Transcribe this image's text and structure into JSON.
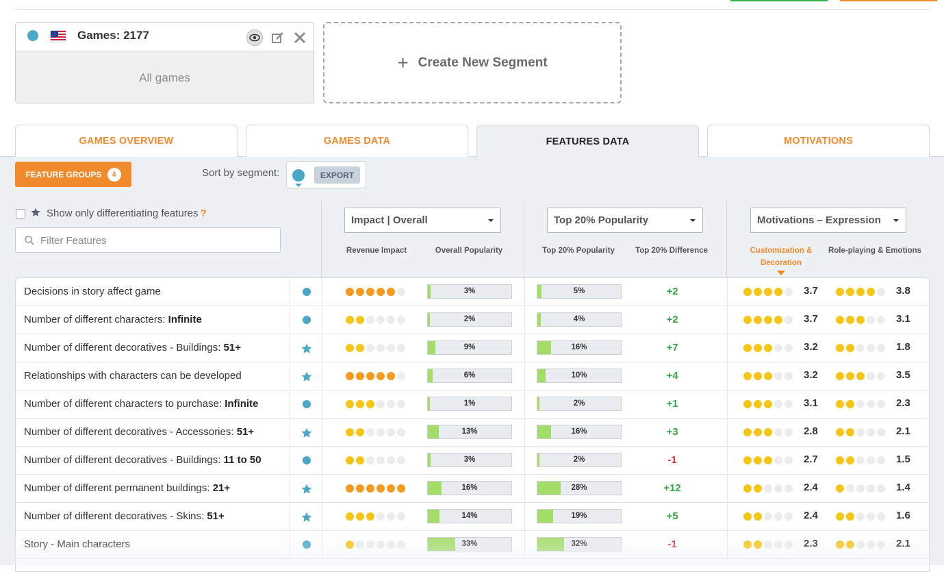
{
  "segment": {
    "title": "Games: 2177",
    "subtitle": "All games",
    "color": "#4aa8c5",
    "country": "US"
  },
  "create_segment": {
    "label": "Create New Segment"
  },
  "tabs": [
    {
      "label": "GAMES OVERVIEW",
      "active": false
    },
    {
      "label": "GAMES DATA",
      "active": false
    },
    {
      "label": "FEATURES DATA",
      "active": true
    },
    {
      "label": "MOTIVATIONS",
      "active": false
    }
  ],
  "toolbar": {
    "feature_groups_label": "FEATURE GROUPS",
    "feature_groups_count": "4",
    "sort_label": "Sort by segment:",
    "export_label": "EXPORT"
  },
  "filters": {
    "differentiating_label": "Show only differentiating features",
    "help": "?",
    "filter_placeholder": "Filter Features"
  },
  "dropdowns": {
    "impact": "Impact | Overall",
    "popularity": "Top 20% Popularity",
    "motivations": "Motivations – Expression"
  },
  "columns": {
    "revenue_impact": "Revenue Impact",
    "overall_popularity": "Overall Popularity",
    "top20_popularity": "Top 20% Popularity",
    "top20_difference": "Top 20% Difference",
    "customization": "Customization & Decoration",
    "roleplaying": "Role-playing & Emotions"
  },
  "rows": [
    {
      "name": "Decisions in story affect game",
      "bold": "",
      "marker": "dot",
      "impact": 5,
      "impact_color": "orange",
      "overall": "3%",
      "overall_pct": 3,
      "top20": "5%",
      "top20_pct": 5,
      "diff": "+2",
      "cust_dots": 4,
      "cust": "3.7",
      "role_dots": 4,
      "role": "3.8"
    },
    {
      "name": "Number of different characters: ",
      "bold": "Infinite",
      "marker": "dot",
      "impact": 2,
      "impact_color": "yellow",
      "overall": "2%",
      "overall_pct": 2,
      "top20": "4%",
      "top20_pct": 4,
      "diff": "+2",
      "cust_dots": 4,
      "cust": "3.7",
      "role_dots": 3,
      "role": "3.1"
    },
    {
      "name": "Number of different decoratives - Buildings: ",
      "bold": "51+",
      "marker": "star",
      "impact": 2,
      "impact_color": "yellow",
      "overall": "9%",
      "overall_pct": 9,
      "top20": "16%",
      "top20_pct": 16,
      "diff": "+7",
      "cust_dots": 3,
      "cust": "3.2",
      "role_dots": 2,
      "role": "1.8"
    },
    {
      "name": "Relationships with characters can be developed",
      "bold": "",
      "marker": "star",
      "impact": 5,
      "impact_color": "orange",
      "overall": "6%",
      "overall_pct": 6,
      "top20": "10%",
      "top20_pct": 10,
      "diff": "+4",
      "cust_dots": 3,
      "cust": "3.2",
      "role_dots": 3,
      "role": "3.5"
    },
    {
      "name": "Number of different characters to purchase: ",
      "bold": "Infinite",
      "marker": "dot",
      "impact": 3,
      "impact_color": "yellow",
      "overall": "1%",
      "overall_pct": 1,
      "top20": "2%",
      "top20_pct": 2,
      "diff": "+1",
      "cust_dots": 3,
      "cust": "3.1",
      "role_dots": 2,
      "role": "2.3"
    },
    {
      "name": "Number of different decoratives - Accessories: ",
      "bold": "51+",
      "marker": "star",
      "impact": 2,
      "impact_color": "yellow",
      "overall": "13%",
      "overall_pct": 13,
      "top20": "16%",
      "top20_pct": 16,
      "diff": "+3",
      "cust_dots": 3,
      "cust": "2.8",
      "role_dots": 2,
      "role": "2.1"
    },
    {
      "name": "Number of different decoratives - Buildings: ",
      "bold": "11 to 50",
      "marker": "dot",
      "impact": 2,
      "impact_color": "yellow",
      "overall": "3%",
      "overall_pct": 3,
      "top20": "2%",
      "top20_pct": 2,
      "diff": "-1",
      "cust_dots": 3,
      "cust": "2.7",
      "role_dots": 2,
      "role": "1.5"
    },
    {
      "name": "Number of different permanent buildings: ",
      "bold": "21+",
      "marker": "star",
      "impact": 6,
      "impact_color": "orange",
      "overall": "16%",
      "overall_pct": 16,
      "top20": "28%",
      "top20_pct": 28,
      "diff": "+12",
      "cust_dots": 2,
      "cust": "2.4",
      "role_dots": 1,
      "role": "1.4"
    },
    {
      "name": "Number of different decoratives - Skins: ",
      "bold": "51+",
      "marker": "star",
      "impact": 3,
      "impact_color": "yellow",
      "overall": "14%",
      "overall_pct": 14,
      "top20": "19%",
      "top20_pct": 19,
      "diff": "+5",
      "cust_dots": 2,
      "cust": "2.4",
      "role_dots": 2,
      "role": "1.6"
    },
    {
      "name": "Story - Main characters",
      "bold": "",
      "marker": "dot",
      "impact": 1,
      "impact_color": "yellow",
      "overall": "33%",
      "overall_pct": 33,
      "top20": "32%",
      "top20_pct": 32,
      "diff": "-1",
      "cust_dots": 2,
      "cust": "2.3",
      "role_dots": 2,
      "role": "2.1"
    }
  ],
  "colors": {
    "accent": "#f08a2a",
    "segment": "#4aa8c5",
    "positive": "#2fa845",
    "negative": "#d32f3a",
    "bar_fill": "#a4dc6a"
  }
}
